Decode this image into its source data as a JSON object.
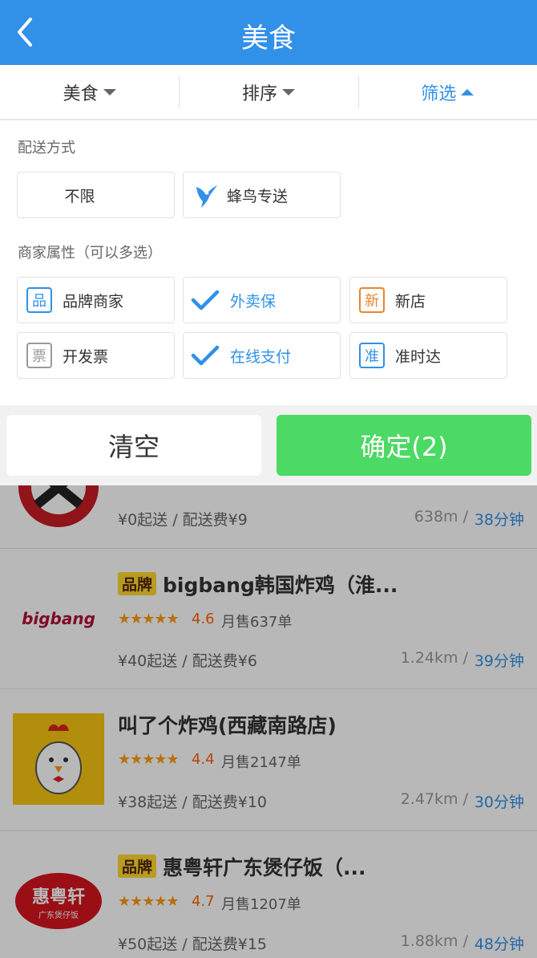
{
  "header": {
    "title": "美食",
    "back_icon": "chevron-left-icon"
  },
  "tabs": [
    {
      "label": "美食",
      "active": false
    },
    {
      "label": "排序",
      "active": false
    },
    {
      "label": "筛选",
      "active": true
    }
  ],
  "filter": {
    "delivery_title": "配送方式",
    "delivery_options": [
      {
        "label": "不限"
      },
      {
        "label": "蜂鸟专送",
        "icon": "hummingbird-icon"
      }
    ],
    "attr_title": "商家属性（可以多选）",
    "attributes": [
      {
        "label": "品牌商家",
        "badge": "品",
        "badge_color": "#3190e8",
        "checked": false
      },
      {
        "label": "外卖保",
        "checked": true
      },
      {
        "label": "新店",
        "badge": "新",
        "badge_color": "#e8842e",
        "checked": false
      },
      {
        "label": "开发票",
        "badge": "票",
        "badge_color": "#999999",
        "checked": false
      },
      {
        "label": "在线支付",
        "checked": true
      },
      {
        "label": "准时达",
        "badge": "准",
        "badge_color": "#3190e8",
        "checked": false
      }
    ],
    "clear_label": "清空",
    "confirm_label": "确定(2)"
  },
  "shops": [
    {
      "name": "",
      "brand": false,
      "delivery": "¥0起送 / 配送费¥9",
      "distance": "638m",
      "separator": "/",
      "time": "38分钟"
    },
    {
      "name": "bigbang韩国炸鸡（淮...",
      "brand": true,
      "brand_label": "品牌",
      "rating": "4.6",
      "stars": 4.6,
      "sales": "月售637单",
      "delivery": "¥40起送 / 配送费¥6",
      "distance": "1.24km",
      "separator": "/",
      "time": "39分钟"
    },
    {
      "name": "叫了个炸鸡(西藏南路店)",
      "brand": false,
      "rating": "4.4",
      "stars": 4.4,
      "sales": "月售2147单",
      "delivery": "¥38起送 / 配送费¥10",
      "distance": "2.47km",
      "separator": "/",
      "time": "30分钟"
    },
    {
      "name": "惠粤轩广东煲仔饭（...",
      "brand": true,
      "brand_label": "品牌",
      "rating": "4.7",
      "stars": 4.7,
      "sales": "月售1207单",
      "delivery": "¥50起送 / 配送费¥15",
      "distance": "1.88km",
      "separator": "/",
      "time": "48分钟"
    }
  ],
  "logo_text": {
    "bigbang": "bigbang",
    "huiyuexuan": "惠粤轩",
    "huiyuexuan_sub": "广东煲仔饭"
  },
  "colors": {
    "primary": "#3190e8",
    "confirm": "#4cd964",
    "rating": "#ff6000",
    "star": "#ff9a0d",
    "brand_badge": "#ffd930"
  }
}
